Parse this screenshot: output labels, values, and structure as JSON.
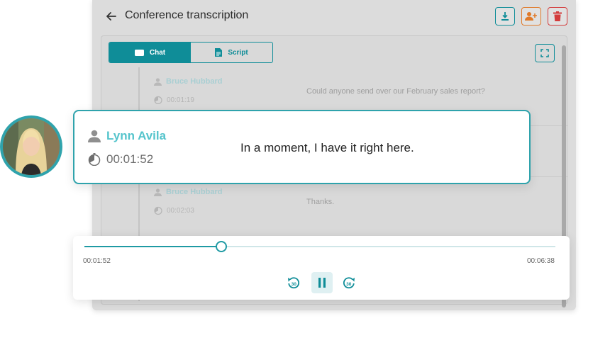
{
  "app": {
    "title": "Conference transcription",
    "icons": {
      "back": "arrow-left-icon",
      "download": "download-icon",
      "add_user": "add-user-icon",
      "delete": "trash-icon",
      "fullscreen": "fullscreen-icon"
    },
    "colors": {
      "accent": "#0f8d98",
      "orange": "#e07a2a",
      "red": "#d33b3b"
    }
  },
  "tabs": [
    {
      "label": "Chat",
      "icon": "keyboard-icon",
      "active": true
    },
    {
      "label": "Script",
      "icon": "document-icon",
      "active": false
    }
  ],
  "messages": [
    {
      "speaker": "Bruce Hubbard",
      "time": "00:01:19",
      "text": "Could anyone send over our February sales report?"
    },
    {
      "speaker": "Bruce Hubbard",
      "time": "00:02:03",
      "text": "Thanks."
    }
  ],
  "highlight": {
    "speaker": "Lynn Avila",
    "time": "00:01:52",
    "text": "In a moment, I have it right here."
  },
  "player": {
    "current": "00:01:52",
    "total": "00:06:38",
    "progress": 0.29,
    "controls": {
      "rewind": "rewind-30-icon",
      "pause": "pause-icon",
      "forward": "forward-30-icon"
    },
    "skip_label": "30"
  }
}
